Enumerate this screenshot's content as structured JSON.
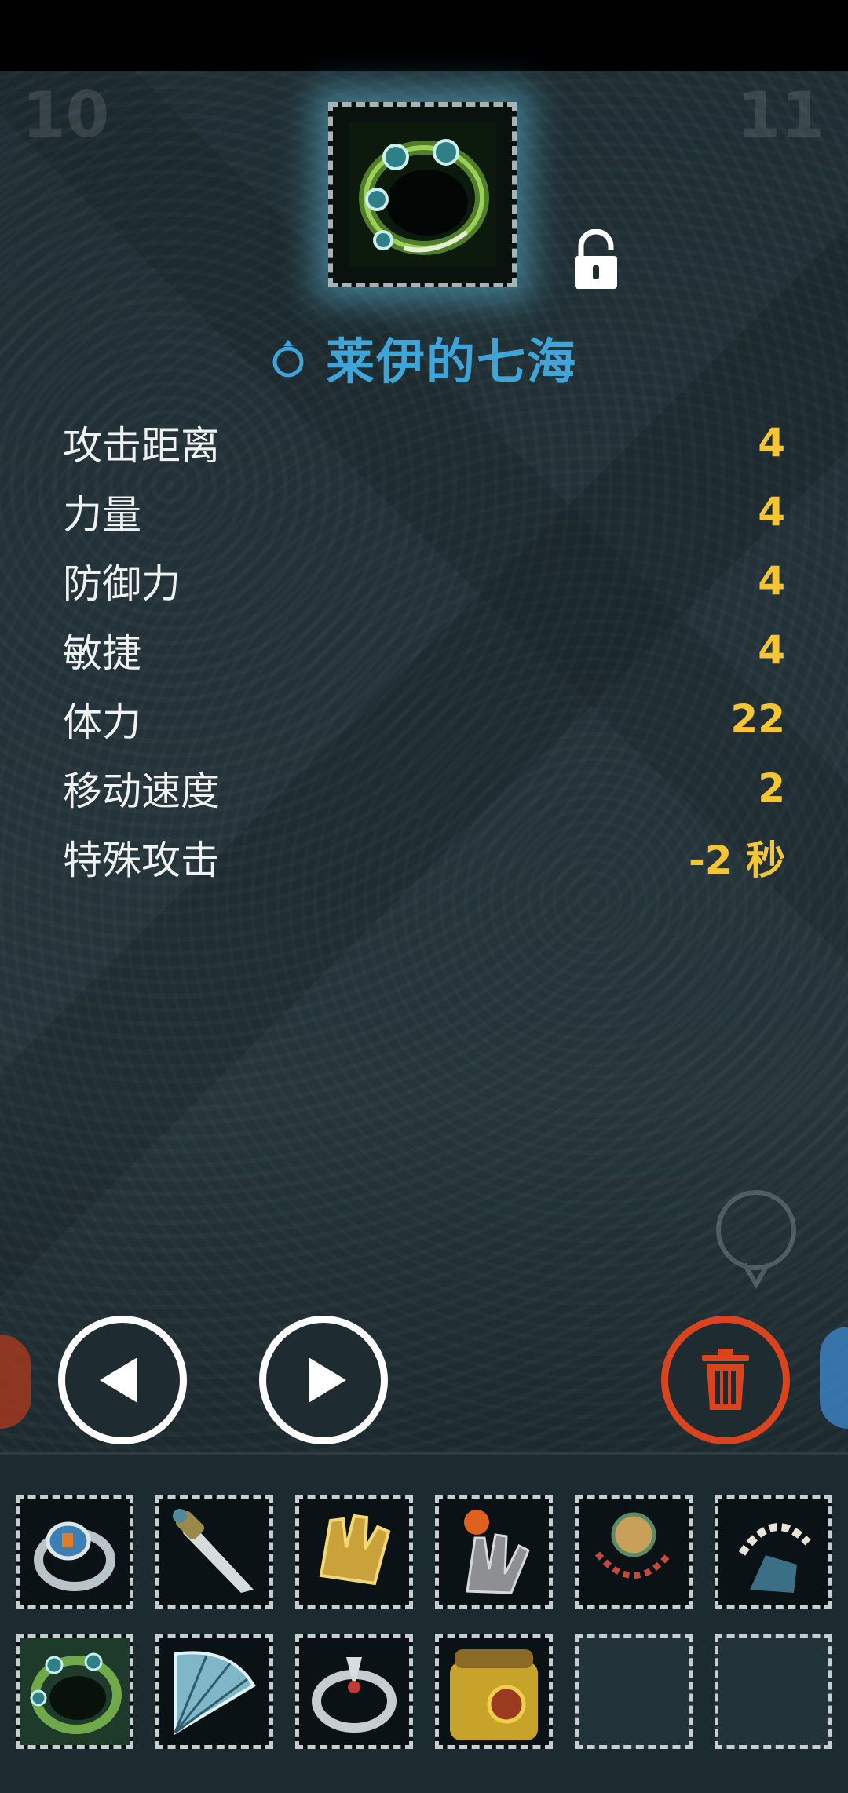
{
  "header": {
    "left_number": "10",
    "right_number": "11"
  },
  "item": {
    "name": "莱伊的七海",
    "icon": "jade-chain-ring-icon",
    "lock_state": "unlocked",
    "title_color": "#3fa5d8"
  },
  "stats": [
    {
      "label": "攻击距离",
      "value": "4"
    },
    {
      "label": "力量",
      "value": "4"
    },
    {
      "label": "防御力",
      "value": "4"
    },
    {
      "label": "敏捷",
      "value": "4"
    },
    {
      "label": "体力",
      "value": "22"
    },
    {
      "label": "移动速度",
      "value": "2"
    },
    {
      "label": "特殊攻击",
      "value": "-2 秒"
    }
  ],
  "colors": {
    "stat_value": "#f4c534",
    "delete_accent": "#d9441e",
    "slot_border": "#c8ced0"
  },
  "controls": {
    "prev_icon": "triangle-left-icon",
    "next_icon": "triangle-right-icon",
    "delete_icon": "trash-can-icon"
  },
  "inventory": {
    "rows": [
      [
        "blue-gem-ring-icon",
        "dagger-icon",
        "golden-gauntlet-icon",
        "flame-claw-icon",
        "beaded-necklace-icon",
        "bone-claw-icon"
      ],
      [
        "jade-chain-ring-icon",
        "ice-fan-icon",
        "silver-serpent-ring-icon",
        "gold-armor-icon",
        "empty-slot",
        "empty-slot"
      ]
    ]
  }
}
